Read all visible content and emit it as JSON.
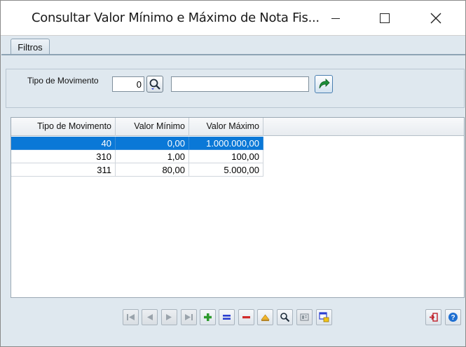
{
  "window": {
    "title": "Consultar Valor Mínimo e Máximo de Nota Fis..."
  },
  "tabs": [
    {
      "label": "Filtros"
    }
  ],
  "filters": {
    "tipo_movimento_label": "Tipo de Movimento",
    "tipo_movimento_code": "0",
    "tipo_movimento_description": ""
  },
  "grid": {
    "columns": [
      "Tipo de Movimento",
      "Valor Mínimo",
      "Valor Máximo"
    ],
    "rows": [
      {
        "tipo": "40",
        "minimo": "0,00",
        "maximo": "1.000.000,00",
        "selected": true
      },
      {
        "tipo": "310",
        "minimo": "1,00",
        "maximo": "100,00",
        "selected": false
      },
      {
        "tipo": "311",
        "minimo": "80,00",
        "maximo": "5.000,00",
        "selected": false
      }
    ]
  },
  "toolbar": {
    "icons": [
      "first-record-icon",
      "prev-record-icon",
      "next-record-icon",
      "last-record-icon",
      "add-icon",
      "edit-icon",
      "delete-icon",
      "cancel-icon",
      "search-icon",
      "form-view-icon",
      "export-icon",
      "exit-icon",
      "help-icon"
    ]
  },
  "colors": {
    "selection": "#0a78d7",
    "add": "#2e9a2e",
    "edit": "#2b3fd1",
    "delete": "#d12b2b",
    "help": "#1f6fd1"
  }
}
